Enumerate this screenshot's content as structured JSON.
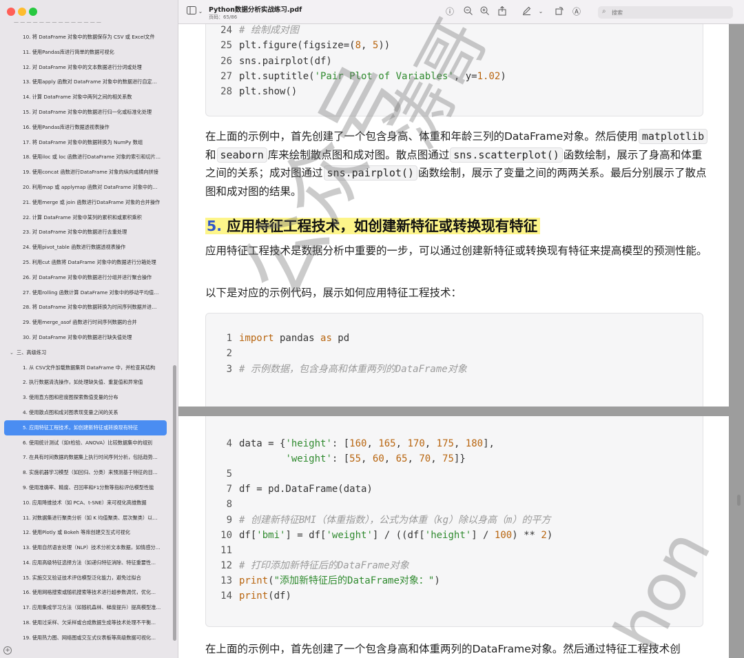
{
  "window": {
    "doc_title": "Python数据分析实战练习.pdf",
    "page_indicator": "页码：65/86",
    "search_placeholder": "搜索"
  },
  "sidebar": {
    "toc": [
      {
        "label": "10. 将 DataFrame 对象中的数据保存为 CSV 或 Excel文件",
        "type": "item"
      },
      {
        "label": "11. 使用Pandas库进行简单的数据可视化",
        "type": "item"
      },
      {
        "label": "12. 对 DataFrame 对象中的文本数据进行分词或处理",
        "type": "item"
      },
      {
        "label": "13. 使用apply 函数对 DataFrame 对象中的数据进行自定义...",
        "type": "item"
      },
      {
        "label": "14. 计算 DataFrame 对象中两列之间的相关系数",
        "type": "item"
      },
      {
        "label": "15. 对 DataFrame 对象中的数据进行归一化或标准化处理",
        "type": "item"
      },
      {
        "label": "16. 使用Pandas库进行数据透视表操作",
        "type": "item"
      },
      {
        "label": "17. 将 DataFrame 对象中的数据转换为 NumPy 数组",
        "type": "item"
      },
      {
        "label": "18. 使用iloc 或 loc 函数进行DataFrame 对象的索引和切片操作",
        "type": "item"
      },
      {
        "label": "19. 使用concat 函数进行DataFrame 对象的纵向或横向拼接",
        "type": "item"
      },
      {
        "label": "20. 利用map 或 applymap 函数对 DataFrame 对象中的数据...",
        "type": "item"
      },
      {
        "label": "21. 使用merge 或 join 函数进行DataFrame 对象的合并操作",
        "type": "item"
      },
      {
        "label": "22. 计算 DataFrame 对象中某列的累积和或累积乘积",
        "type": "item"
      },
      {
        "label": "23. 对 DataFrame 对象中的数据进行去重处理",
        "type": "item"
      },
      {
        "label": "24. 使用pivot_table 函数进行数据透视表操作",
        "type": "item"
      },
      {
        "label": "25. 利用cut 函数将 DataFrame 对象中的数据进行分箱处理",
        "type": "item"
      },
      {
        "label": "26. 对 DataFrame 对象中的数据进行分组并进行聚合操作",
        "type": "item"
      },
      {
        "label": "27. 使用rolling 函数计算 DataFrame 对象中的移动平均值或...",
        "type": "item"
      },
      {
        "label": "28. 将 DataFrame 对象中的数据转换为时间序列数据并进行...",
        "type": "item"
      },
      {
        "label": "29. 使用merge_asof 函数进行时间序列数据的合并",
        "type": "item"
      },
      {
        "label": "30. 对 DataFrame 对象中的数据进行缺失值处理",
        "type": "item"
      },
      {
        "label": "三、高级练习",
        "type": "section"
      },
      {
        "label": "1. 从 CSV文件加载数据集到 DataFrame 中，并检查其结构",
        "type": "item"
      },
      {
        "label": "2. 执行数据清洗操作，如处理缺失值、重复值和异常值",
        "type": "item"
      },
      {
        "label": "3. 使用直方图和密度图探索数值变量的分布",
        "type": "item"
      },
      {
        "label": "4. 使用散点图和成对图表现变量之间的关系",
        "type": "item"
      },
      {
        "label": "5. 应用特征工程技术，如创建新特征或转换现有特征",
        "type": "item",
        "selected": true
      },
      {
        "label": "6. 使用统计测试（如t检验、ANOVA）比较数据集中的组别",
        "type": "item"
      },
      {
        "label": "7. 在具有时间数据的数据集上执行时间序列分析，包括趋势...",
        "type": "item"
      },
      {
        "label": "8. 实施机器学习模型（如回归、分类）来预测基于特征的目...",
        "type": "item"
      },
      {
        "label": "9. 使用准确率、精度、召回率和F1分数等指标评估模型性能",
        "type": "item"
      },
      {
        "label": "10. 应用降维技术（如 PCA、t-SNE）来可视化高维数据",
        "type": "item"
      },
      {
        "label": "11. 对数据集进行聚类分析（如 K 均值聚类、层次聚类）以识...",
        "type": "item"
      },
      {
        "label": "12. 使用Plotly 或 Bokeh 等库创建交互式可视化",
        "type": "item"
      },
      {
        "label": "13. 使用自然语言处理（NLP）技术分析文本数据，如情感分...",
        "type": "item"
      },
      {
        "label": "14. 应用高级特征选择方法（如递归特征消除、特征重要性...",
        "type": "item"
      },
      {
        "label": "15. 实施交叉验证技术评估模型泛化能力，避免过拟合",
        "type": "item"
      },
      {
        "label": "16. 使用网格搜索或随机搜索等技术进行超参数调优，优化...",
        "type": "item"
      },
      {
        "label": "17. 应用集成学习方法（如随机森林、梯度提升）提高模型准...",
        "type": "item"
      },
      {
        "label": "18. 使用过采样、欠采样或合成数据生成等技术处理不平衡...",
        "type": "item"
      },
      {
        "label": "19. 使用热力图、网络图或交互式仪表板等高级数据可视化...",
        "type": "item"
      }
    ]
  },
  "page1": {
    "code_lines": [
      {
        "n": "24",
        "parts": [
          {
            "t": "# 绘制成对图",
            "c": "cm"
          }
        ]
      },
      {
        "n": "25",
        "parts": [
          {
            "t": "plt.figure(figsize=(",
            "c": ""
          },
          {
            "t": "8",
            "c": "num"
          },
          {
            "t": ", ",
            "c": ""
          },
          {
            "t": "5",
            "c": "num"
          },
          {
            "t": "))",
            "c": ""
          }
        ]
      },
      {
        "n": "26",
        "parts": [
          {
            "t": "sns.pairplot(df)",
            "c": ""
          }
        ]
      },
      {
        "n": "27",
        "parts": [
          {
            "t": "plt.suptitle(",
            "c": ""
          },
          {
            "t": "'Pair Plot of Variables'",
            "c": "str"
          },
          {
            "t": ", y=",
            "c": ""
          },
          {
            "t": "1.02",
            "c": "num"
          },
          {
            "t": ")",
            "c": ""
          }
        ]
      },
      {
        "n": "28",
        "parts": [
          {
            "t": "plt.show()",
            "c": ""
          }
        ]
      }
    ],
    "para1": [
      {
        "t": "在上面的示例中，首先创建了一个包含身高、体重和年龄三列的DataFrame对象。然后使用",
        "code": false
      },
      {
        "t": "matplotlib",
        "code": true
      },
      {
        "t": "和",
        "code": false
      },
      {
        "t": "seaborn",
        "code": true
      },
      {
        "t": "库来绘制散点图和成对图。散点图通过",
        "code": false
      },
      {
        "t": "sns.scatterplot()",
        "code": true
      },
      {
        "t": "函数绘制，展示了身高和体重之间的关系；成对图通过",
        "code": false
      },
      {
        "t": "sns.pairplot()",
        "code": true
      },
      {
        "t": "函数绘制，展示了变量之间的两两关系。最后分别展示了散点图和成对图的结果。",
        "code": false
      }
    ],
    "heading_num": "5.",
    "heading_text": "应用特征工程技术，如创建新特征或转换现有特征",
    "para2": "应用特征工程技术是数据分析中重要的一步，可以通过创建新特征或转换现有特征来提高模型的预测性能。",
    "para3": "以下是对应的示例代码，展示如何应用特征工程技术：",
    "code2_lines": [
      {
        "n": "1",
        "parts": [
          {
            "t": "import",
            "c": "kw"
          },
          {
            "t": " pandas ",
            "c": ""
          },
          {
            "t": "as",
            "c": "kw"
          },
          {
            "t": " pd",
            "c": ""
          }
        ]
      },
      {
        "n": "2",
        "parts": []
      },
      {
        "n": "3",
        "parts": [
          {
            "t": "# 示例数据，包含身高和体重两列的DataFrame对象",
            "c": "cm"
          }
        ]
      }
    ]
  },
  "page2": {
    "code_lines": [
      {
        "n": "4",
        "parts": [
          {
            "t": "data = {",
            "c": ""
          },
          {
            "t": "'height'",
            "c": "str"
          },
          {
            "t": ": [",
            "c": ""
          },
          {
            "t": "160",
            "c": "num"
          },
          {
            "t": ", ",
            "c": ""
          },
          {
            "t": "165",
            "c": "num"
          },
          {
            "t": ", ",
            "c": ""
          },
          {
            "t": "170",
            "c": "num"
          },
          {
            "t": ", ",
            "c": ""
          },
          {
            "t": "175",
            "c": "num"
          },
          {
            "t": ", ",
            "c": ""
          },
          {
            "t": "180",
            "c": "num"
          },
          {
            "t": "],",
            "c": ""
          }
        ]
      },
      {
        "n": "",
        "parts": [
          {
            "t": "        ",
            "c": ""
          },
          {
            "t": "'weight'",
            "c": "str"
          },
          {
            "t": ": [",
            "c": ""
          },
          {
            "t": "55",
            "c": "num"
          },
          {
            "t": ", ",
            "c": ""
          },
          {
            "t": "60",
            "c": "num"
          },
          {
            "t": ", ",
            "c": ""
          },
          {
            "t": "65",
            "c": "num"
          },
          {
            "t": ", ",
            "c": ""
          },
          {
            "t": "70",
            "c": "num"
          },
          {
            "t": ", ",
            "c": ""
          },
          {
            "t": "75",
            "c": "num"
          },
          {
            "t": "]}",
            "c": ""
          }
        ]
      },
      {
        "n": "5",
        "parts": []
      },
      {
        "n": "7",
        "parts": [
          {
            "t": "df = pd.DataFrame(data)",
            "c": ""
          }
        ]
      },
      {
        "n": "8",
        "parts": []
      },
      {
        "n": "9",
        "parts": [
          {
            "t": "# 创建新特征BMI（体重指数），公式为体重（kg）除以身高（m）的平方",
            "c": "cm"
          }
        ]
      },
      {
        "n": "10",
        "parts": [
          {
            "t": "df[",
            "c": ""
          },
          {
            "t": "'bmi'",
            "c": "str"
          },
          {
            "t": "] = df[",
            "c": ""
          },
          {
            "t": "'weight'",
            "c": "str"
          },
          {
            "t": "] / ((df[",
            "c": ""
          },
          {
            "t": "'height'",
            "c": "str"
          },
          {
            "t": "] / ",
            "c": ""
          },
          {
            "t": "100",
            "c": "num"
          },
          {
            "t": ") ** ",
            "c": ""
          },
          {
            "t": "2",
            "c": "num"
          },
          {
            "t": ")",
            "c": ""
          }
        ]
      },
      {
        "n": "11",
        "parts": []
      },
      {
        "n": "12",
        "parts": [
          {
            "t": "# 打印添加新特征后的DataFrame对象",
            "c": "cm"
          }
        ]
      },
      {
        "n": "13",
        "parts": [
          {
            "t": "print",
            "c": "kw"
          },
          {
            "t": "(",
            "c": ""
          },
          {
            "t": "\"添加新特征后的DataFrame对象：\"",
            "c": "str"
          },
          {
            "t": ")",
            "c": ""
          }
        ]
      },
      {
        "n": "14",
        "parts": [
          {
            "t": "print",
            "c": "kw"
          },
          {
            "t": "(df)",
            "c": ""
          }
        ]
      }
    ],
    "para1": "在上面的示例中，首先创建了一个包含身高和体重两列的DataFrame对象。然后通过特征工程技术创"
  },
  "watermark": {
    "text1": "公众号",
    "text2": "涛哥",
    "text3": "hon"
  },
  "colors": {
    "selected": "#4a8df2",
    "highlight": "#fdf58a",
    "heading_number": "#2f55c9",
    "code_string": "#2f8a2e",
    "code_keyword": "#b8650f",
    "code_comment": "#9a9a9a"
  }
}
